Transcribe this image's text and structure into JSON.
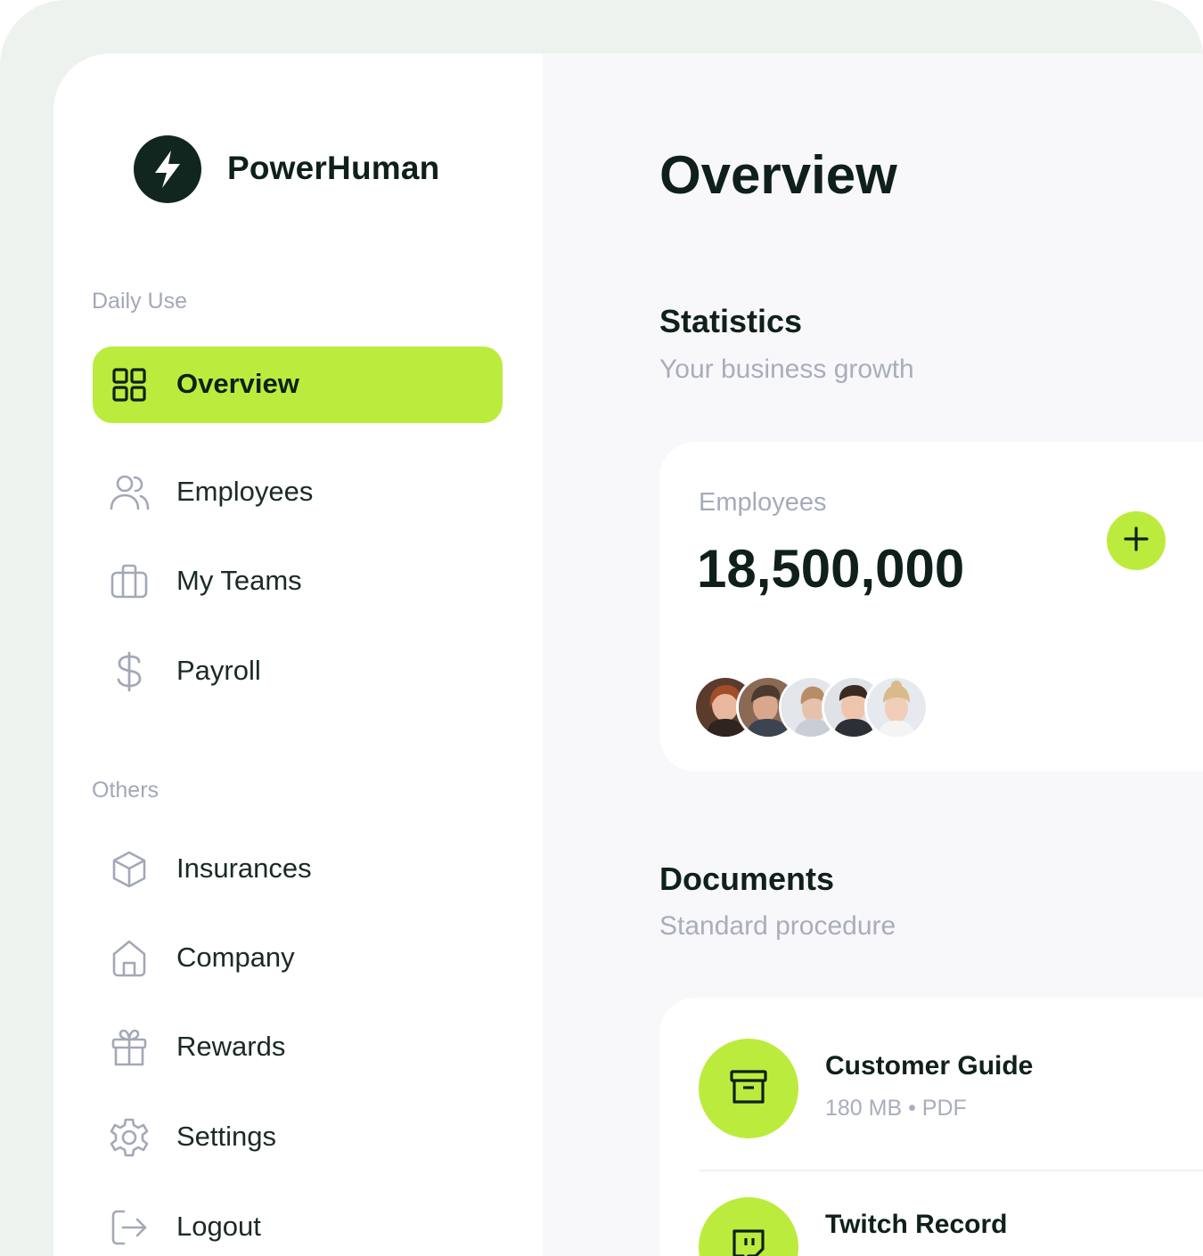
{
  "brand": {
    "name": "PowerHuman"
  },
  "sidebar": {
    "section_daily": "Daily Use",
    "section_others": "Others",
    "items": [
      {
        "label": "Overview",
        "icon": "grid-icon",
        "active": true
      },
      {
        "label": "Employees",
        "icon": "users-icon"
      },
      {
        "label": "My Teams",
        "icon": "briefcase-icon"
      },
      {
        "label": "Payroll",
        "icon": "dollar-icon"
      },
      {
        "label": "Insurances",
        "icon": "box-icon"
      },
      {
        "label": "Company",
        "icon": "home-icon"
      },
      {
        "label": "Rewards",
        "icon": "gift-icon"
      },
      {
        "label": "Settings",
        "icon": "gear-icon"
      },
      {
        "label": "Logout",
        "icon": "logout-icon"
      }
    ]
  },
  "main": {
    "title": "Overview",
    "statistics": {
      "title": "Statistics",
      "subtitle": "Your business growth",
      "card": {
        "label": "Employees",
        "value": "18,500,000",
        "add_icon": "plus-icon"
      }
    },
    "documents": {
      "title": "Documents",
      "subtitle": "Standard procedure",
      "items": [
        {
          "title": "Customer Guide",
          "meta": "180 MB • PDF",
          "icon": "archive-icon"
        },
        {
          "title": "Twitch Record",
          "icon": "twitch-icon"
        }
      ]
    }
  },
  "colors": {
    "accent": "#bbec3d",
    "dark": "#122620",
    "muted": "#a9adbd",
    "background": "#f8f8fa"
  }
}
